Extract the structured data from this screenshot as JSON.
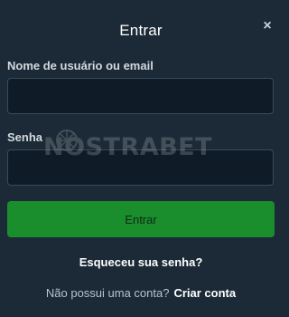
{
  "modal": {
    "title": "Entrar",
    "close_symbol": "×"
  },
  "form": {
    "username_label": "Nome de usuário ou email",
    "username_value": "",
    "password_label": "Senha",
    "password_value": "",
    "submit_label": "Entrar"
  },
  "links": {
    "forgot_password": "Esqueceu sua senha?",
    "no_account_prompt": "Não possui uma conta?",
    "create_account": "Criar conta"
  },
  "watermark": {
    "text": "NOSTRABET"
  },
  "colors": {
    "background": "#1b2a36",
    "input_background": "#0f1c27",
    "submit_button": "#1a8d2c",
    "text_primary": "#ffffff"
  }
}
